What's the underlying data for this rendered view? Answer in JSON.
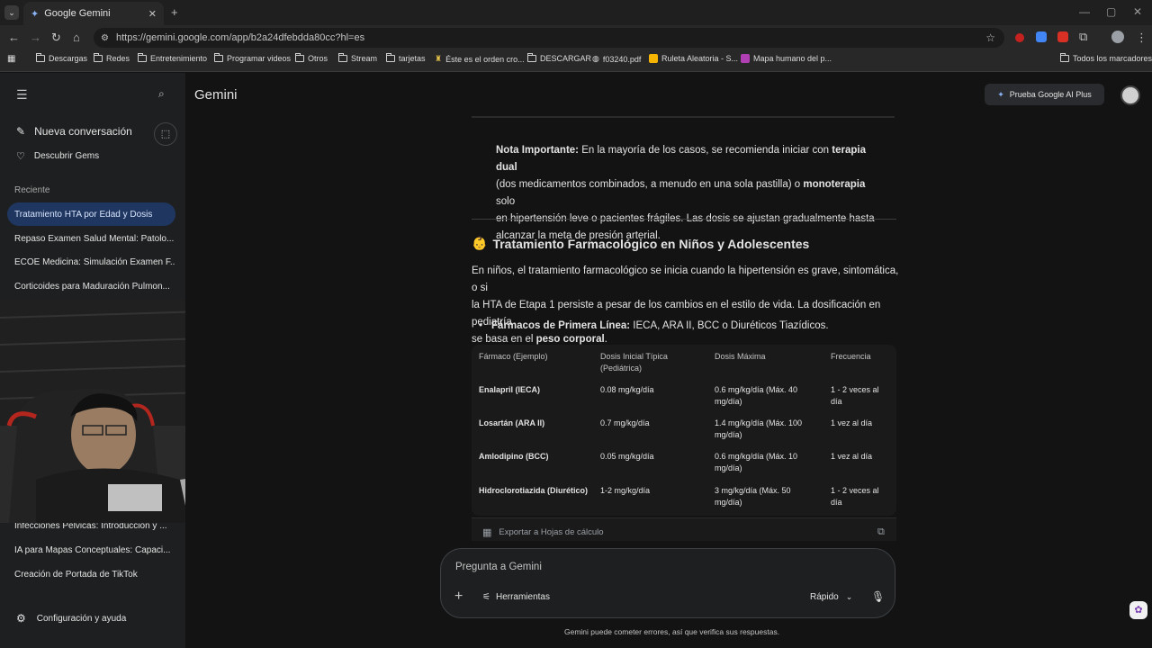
{
  "browser": {
    "tab_title": "Google Gemini",
    "new_tab_symbol": "+",
    "url": "https://gemini.google.com/app/b2a24dfebdda80cc?hl=es",
    "bookmarks": [
      "Descargas",
      "Redes",
      "Entretenimiento",
      "Programar videos",
      "Otros",
      "Stream",
      "tarjetas",
      "Éste es el orden cro...",
      "DESCARGAR",
      "f03240.pdf",
      "Ruleta Aleatoria - S...",
      "Mapa humano del p..."
    ],
    "all_bookmarks": "Todos los marcadores"
  },
  "sidebar": {
    "new_chat": "Nueva conversación",
    "discover_gems": "Descubrir Gems",
    "recent_label": "Reciente",
    "recent": [
      "Tratamiento HTA por Edad y Dosis",
      "Repaso Examen Salud Mental: Patolo...",
      "ECOE Medicina: Simulación Examen F...",
      "Corticoides para Maduración Pulmon...",
      "Infecciones Pélvicas: Introducción y ...",
      "IA para Mapas Conceptuales: Capaci...",
      "Creación de Portada de TikTok"
    ],
    "settings": "Configuración y ayuda"
  },
  "header": {
    "title": "Gemini",
    "upgrade": "Prueba Google AI Plus"
  },
  "content": {
    "note_bold": "Nota Importante:",
    "note_1": " En la mayoría de los casos, se recomienda iniciar con ",
    "note_bold2": "terapia dual",
    "note_2": "(dos medicamentos combinados, a menudo en una sola pastilla) o ",
    "note_bold3": "monoterapia",
    "note_3": " solo",
    "note_4": "en hipertensión leve o pacientes frágiles. Las dosis se ajustan gradualmente hasta",
    "note_5": "alcanzar la meta de presión arterial.",
    "section_emoji": "👶",
    "section_title": "Tratamiento Farmacológico en Niños y Adolescentes",
    "para_1": "En niños, el tratamiento farmacológico se inicia cuando la hipertensión es grave, sintomática, o si",
    "para_2": "la HTA de Etapa 1 persiste a pesar de los cambios en el estilo de vida. La dosificación en pediatría",
    "para_3": "se basa en el ",
    "para_bold": "peso corporal",
    "para_end": ".",
    "bullet_bold": "Fármacos de Primera Línea:",
    "bullet_text": " IECA, ARA II, BCC o Diuréticos Tiazídicos."
  },
  "table": {
    "headers": [
      "Fármaco (Ejemplo)",
      "Dosis Inicial Típica (Pediátrica)",
      "Dosis Máxima",
      "Frecuencia"
    ],
    "rows": [
      [
        "Enalapril (IECA)",
        "0.08 mg/kg/día",
        "0.6 mg/kg/día (Máx. 40 mg/día)",
        "1 - 2 veces al día"
      ],
      [
        "Losartán (ARA II)",
        "0.7 mg/kg/día",
        "1.4 mg/kg/día (Máx. 100 mg/día)",
        "1 vez al día"
      ],
      [
        "Amlodipino (BCC)",
        "0.05 mg/kg/día",
        "0.6 mg/kg/día (Máx. 10 mg/día)",
        "1 vez al día"
      ],
      [
        "Hidroclorotiazida (Diurético)",
        "1-2 mg/kg/día",
        "3 mg/kg/día (Máx. 50 mg/día)",
        "1 - 2 veces al día"
      ]
    ],
    "export": "Exportar a Hojas de cálculo"
  },
  "input": {
    "placeholder": "Pregunta a Gemini",
    "tools": "Herramientas",
    "mode": "Rápido",
    "plus": "+"
  },
  "footer": "Gemini puede cometer errores, así que verifica sus respuestas."
}
